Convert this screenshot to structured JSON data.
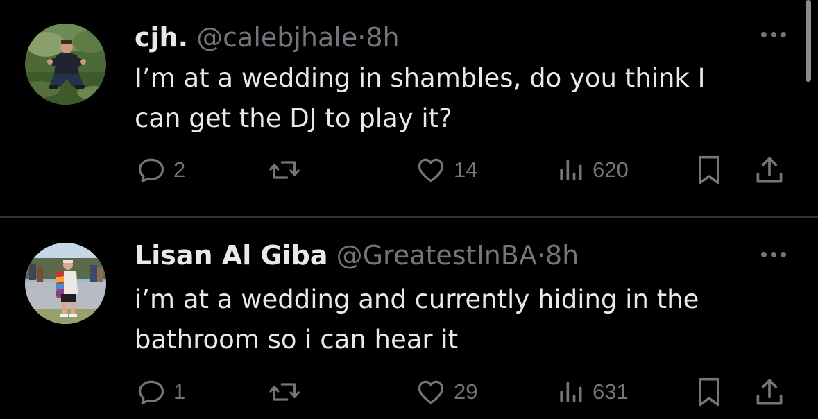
{
  "tweets": [
    {
      "display_name": "cjh.",
      "handle": "@calebjhale",
      "separator": "·",
      "time": "8h",
      "text": "I’m at a wedding in shambles, do you think I can get the DJ to play it?",
      "replies": "2",
      "retweets": "",
      "likes": "14",
      "views": "620",
      "avatar_icon": "avatar-photo-man-crouching-on-grass"
    },
    {
      "display_name": "Lisan Al Giba",
      "handle": "@GreatestInBA",
      "separator": "·",
      "time": "8h",
      "text": "i’m at a wedding and currently hiding in the bathroom so i can hear it",
      "replies": "1",
      "retweets": "",
      "likes": "29",
      "views": "631",
      "avatar_icon": "avatar-photo-man-with-flag-outdoors"
    }
  ],
  "colors": {
    "background": "#000000",
    "text_primary": "#e7e9ea",
    "text_secondary": "#71767b",
    "divider": "#2f3336"
  }
}
